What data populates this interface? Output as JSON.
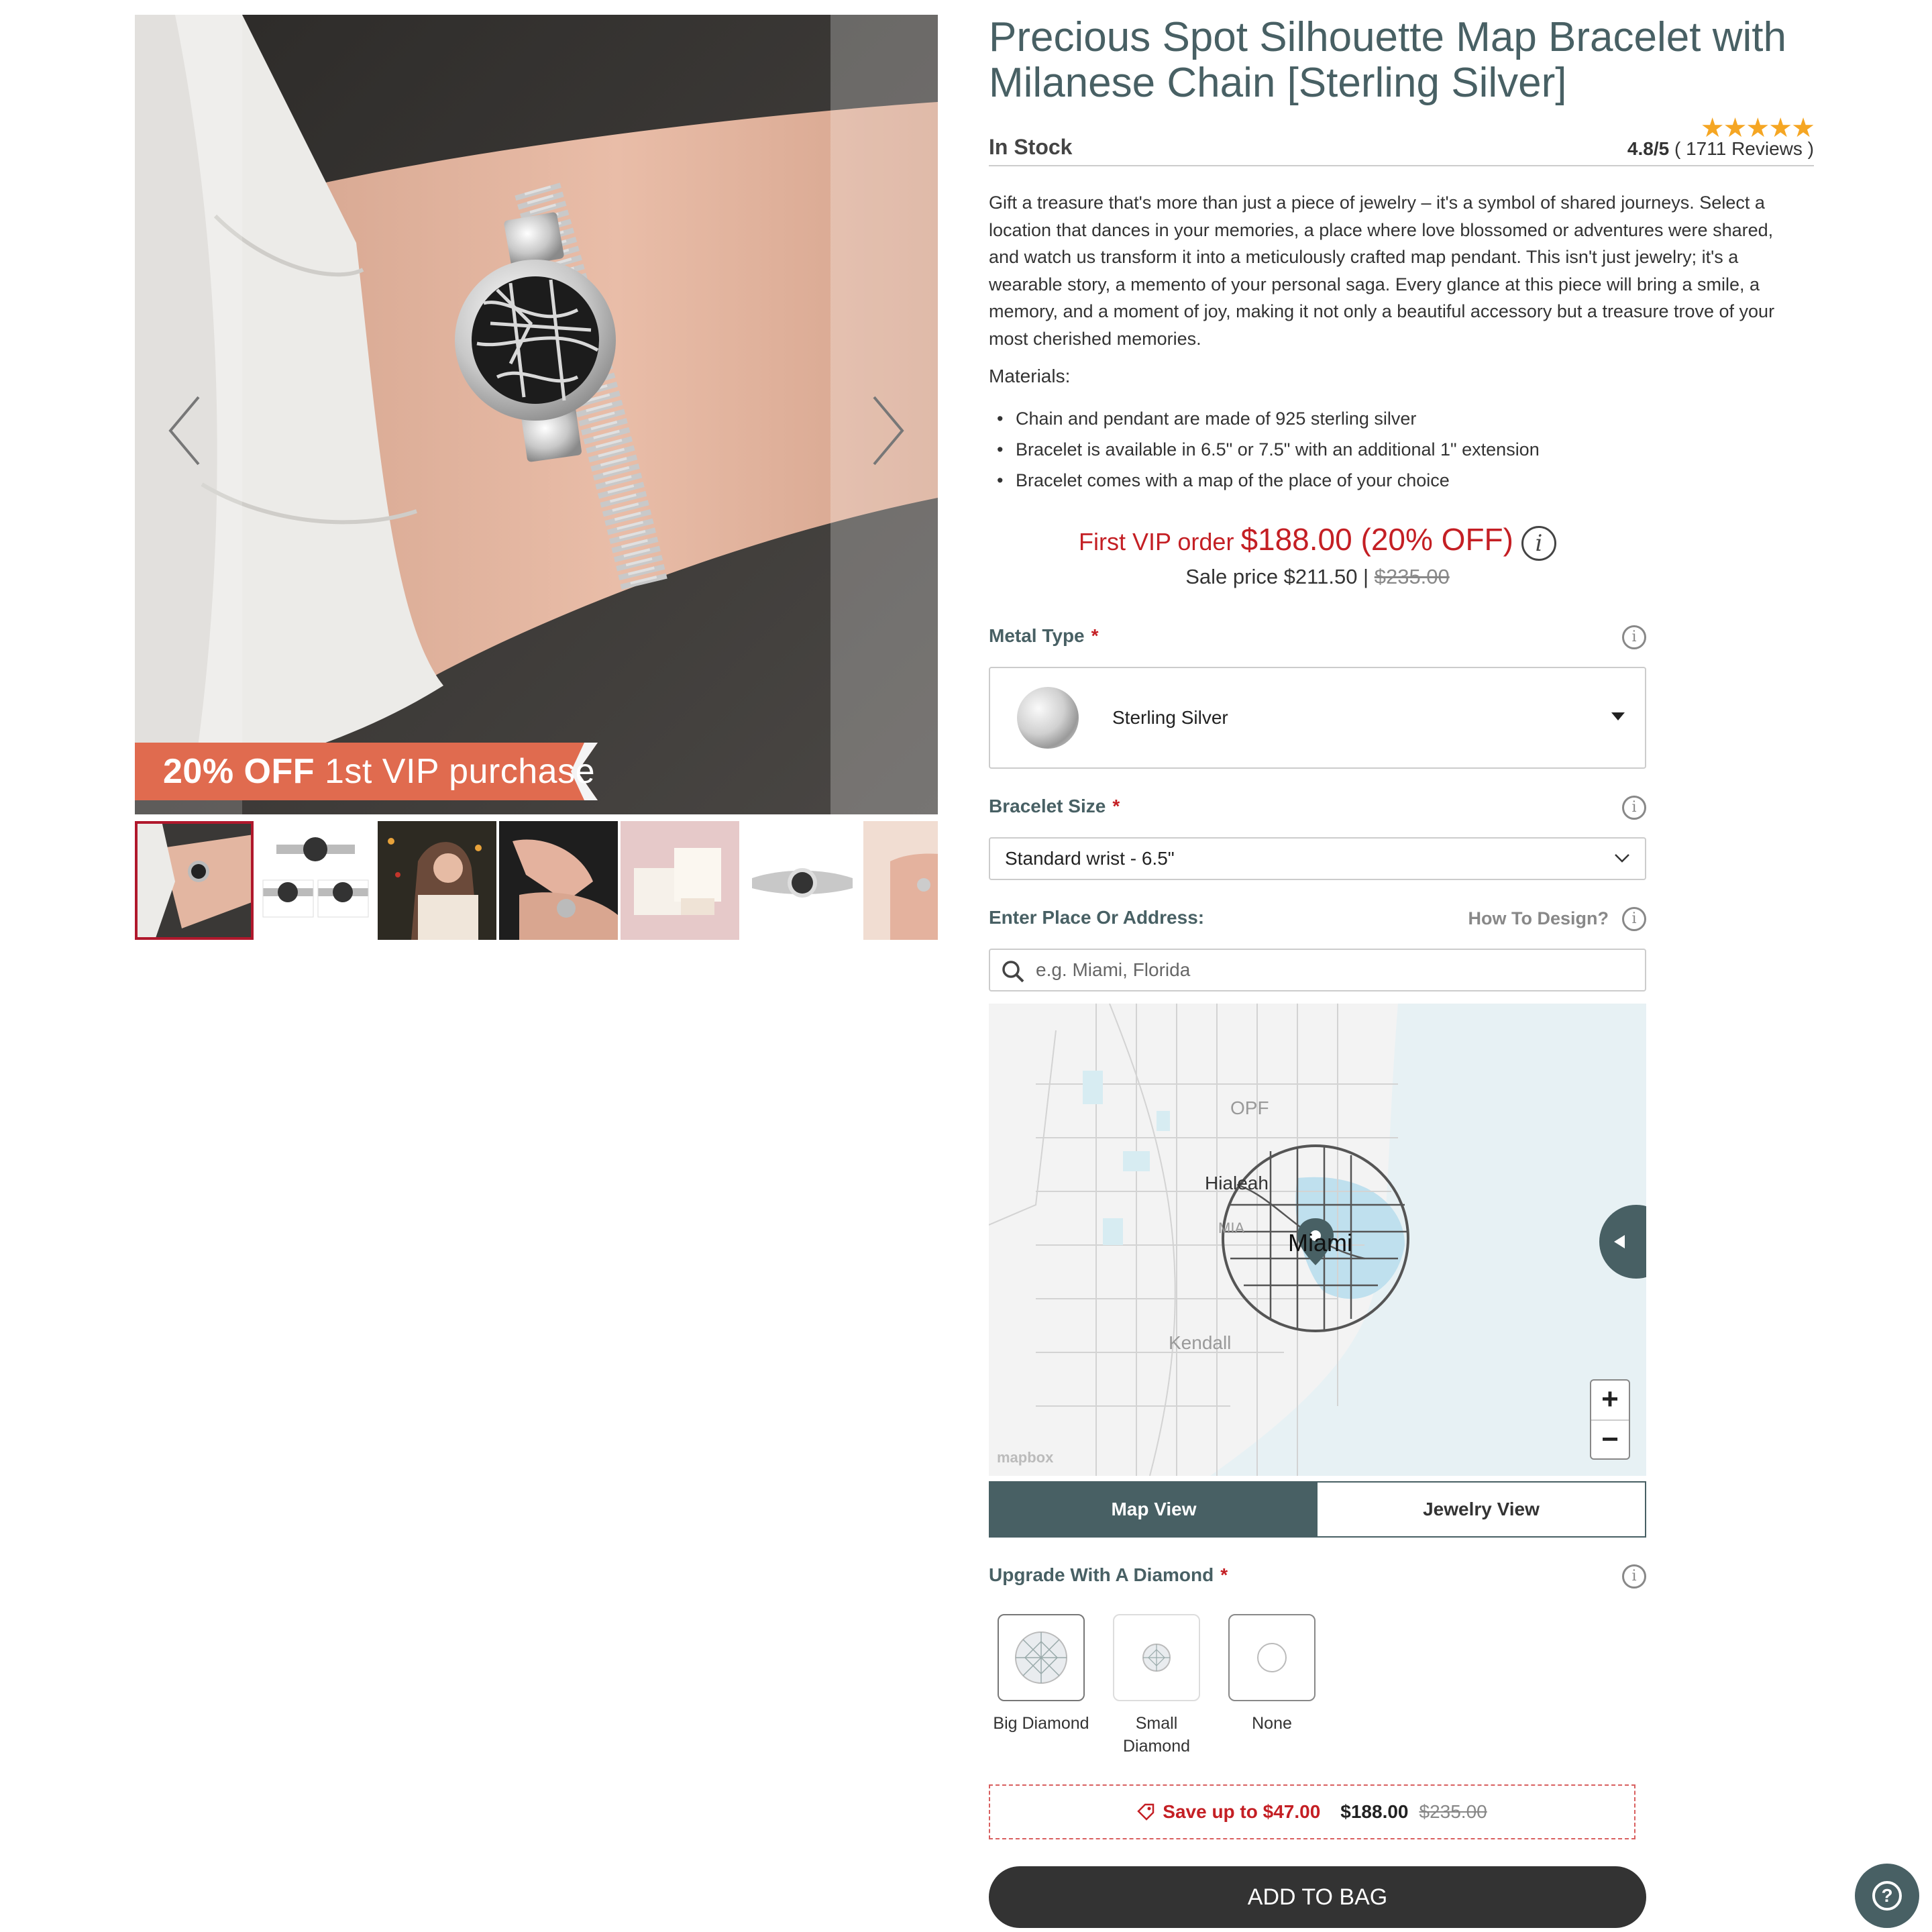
{
  "gallery": {
    "promo": {
      "pct": "20%",
      "off": " OFF",
      "rest": " 1st VIP purchase"
    },
    "thumb_count": 7,
    "active_thumb": 0
  },
  "product": {
    "title": "Precious Spot Silhouette Map Bracelet with Milanese Chain [Sterling Silver]",
    "stock": "In Stock",
    "stars": "★★★★★",
    "rating_score": "4.8/5",
    "rating_count": " ( 1711 Reviews )",
    "description": "Gift a treasure that's more than just a piece of jewelry – it's a symbol of shared journeys. Select a location that dances in your memories, a place where love blossomed or adventures were shared, and watch us transform it into a meticulously crafted map pendant. This isn't just jewelry; it's a wearable story, a memento of your personal saga. Every glance at this piece will bring a smile, a memory, and a moment of joy, making it not only a beautiful accessory but a treasure trove of your most cherished memories.",
    "materials_label": "Materials:",
    "materials": [
      "Chain and pendant are made of 925 sterling silver",
      "Bracelet is available in 6.5\" or 7.5\" with an additional 1\" extension",
      "Bracelet comes with a map of the place of your choice"
    ]
  },
  "pricing": {
    "vip_label": "First VIP order ",
    "vip_price": "$188.00 (20% OFF)",
    "info_glyph": "i",
    "sale_label": "Sale price $211.50 | ",
    "original": "$235.00"
  },
  "options": {
    "metal_label": "Metal Type",
    "metal_value": "Sterling Silver",
    "size_label": "Bracelet Size",
    "size_value": "Standard wrist - 6.5\"",
    "place_label": "Enter Place Or Address:",
    "how_to": "How To Design?",
    "search_placeholder": "e.g. Miami, Florida",
    "required_mark": "*",
    "info_glyph": "i"
  },
  "map": {
    "labels": {
      "hialeah": "Hialeah",
      "mia": "MIA",
      "kendall": "Kendall",
      "opf": "OPF",
      "city": "Miami"
    },
    "attribution": "mapbox",
    "zoom_in": "+",
    "zoom_out": "−"
  },
  "view_toggle": {
    "map": "Map View",
    "jewelry": "Jewelry View"
  },
  "diamond": {
    "label": "Upgrade With A Diamond",
    "options": [
      "Big Diamond",
      "Small Diamond",
      "None"
    ]
  },
  "savings": {
    "save_text": "Save up to $47.00",
    "now": "$188.00",
    "was": "$235.00"
  },
  "cta": {
    "add_to_bag": "ADD TO BAG"
  },
  "colors": {
    "accent": "#486064",
    "sale_red": "#c41f24",
    "star": "#f5a623"
  }
}
